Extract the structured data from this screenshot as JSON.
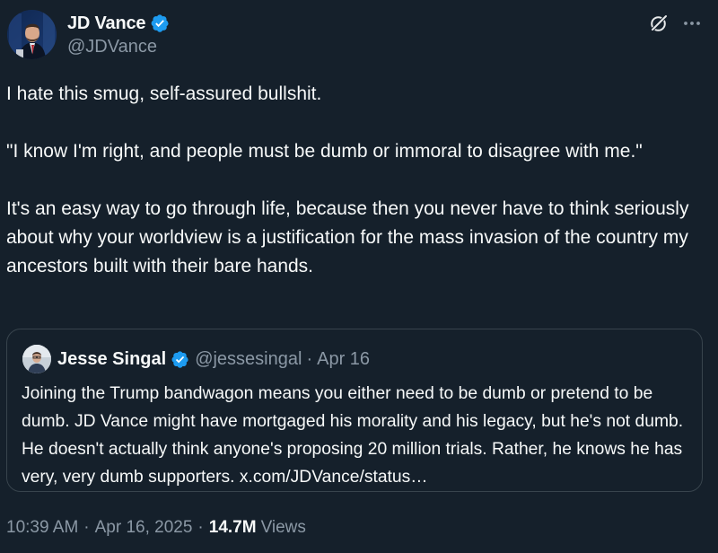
{
  "author": {
    "name": "JD Vance",
    "handle": "@JDVance",
    "verified": true
  },
  "icons": {
    "verified": "verified-badge-icon",
    "grok": "grok-icon",
    "more": "more-options-icon"
  },
  "colors": {
    "background": "#15202b",
    "text": "#f7f9f9",
    "secondary_text": "#8b98a5",
    "verified_blue": "#1d9bf0",
    "border": "#38444d"
  },
  "tweet": {
    "paragraphs": [
      "I hate this smug, self-assured bullshit.",
      "\"I know I'm right, and people must be dumb or immoral to disagree with me.\"",
      "It's an easy way to go through life, because then you never have to think seriously about why your worldview is a justification for the mass invasion of the country my ancestors built with their bare hands."
    ]
  },
  "quote": {
    "name": "Jesse Singal",
    "handle": "@jessesingal",
    "separator": "·",
    "date": "Apr 16",
    "verified": true,
    "text": "Joining the Trump bandwagon means you either need to be dumb or pretend to be dumb. JD Vance might have mortgaged his morality and his legacy, but he's not dumb. He doesn't actually think anyone's proposing 20 million trials. Rather, he knows he has very, very dumb supporters. x.com/JDVance/status…"
  },
  "meta": {
    "time": "10:39 AM",
    "separator": "·",
    "date": "Apr 16, 2025",
    "views_count": "14.7M",
    "views_label": "Views"
  }
}
